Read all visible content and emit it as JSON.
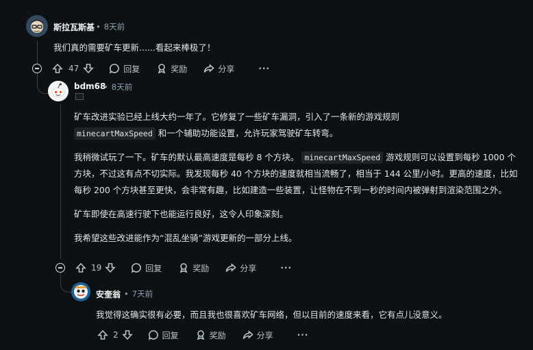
{
  "comments": [
    {
      "author": "斯拉瓦斯基",
      "time": "8天前",
      "body": "我们真的需要矿车更新......看起来棒极了！",
      "votes": "47",
      "reply_label": "回复",
      "award_label": "奖励",
      "share_label": "分享",
      "more_label": "···"
    },
    {
      "author": "bdm68",
      "time": "8天前",
      "p1a": "矿车改进实验已经上线大约一年了。它修复了一些矿车漏洞，引入了一条新的游戏规则",
      "p1code": "minecartMaxSpeed",
      "p1b": "和一个辅助功能设置，允许玩家驾驶矿车转弯。",
      "p2a": "我稍微试玩了一下。矿车的默认最高速度是每秒 8 个方块。",
      "p2code": "minecartMaxSpeed",
      "p2b": "游戏规则可以设置到每秒 1000 个方块，不过这有点不切实际。我发现每秒 40 个方块的速度就相当流畅了，相当于 144 公里/小时。更高的速度，比如每秒 200 个方块甚至更快，会非常有趣，比如建造一些装置，让怪物在不到一秒的时间内被弹射到渲染范围之外。",
      "p3": "矿车即使在高速行驶下也能运行良好，这令人印象深刻。",
      "p4": "我希望这些改进能作为“混乱坐骑”游戏更新的一部分上线。",
      "votes": "19",
      "reply_label": "回复",
      "award_label": "奖励",
      "share_label": "分享",
      "more_label": "···"
    },
    {
      "author": "安奎翁",
      "time": "7天前",
      "body": "我觉得这确实很有必要，而且我也很喜欢矿车网络，但以目前的速度来看，它有点儿没意义。",
      "votes": "2",
      "reply_label": "回复",
      "award_label": "奖励",
      "share_label": "分享",
      "more_label": "···"
    }
  ],
  "icons": {
    "upvote": "arrow-up-icon",
    "downvote": "arrow-down-icon",
    "reply": "speech-bubble-icon",
    "award": "award-icon",
    "share": "share-arrow-icon",
    "collapse": "minus-circle-icon"
  },
  "colors": {
    "background": "#0e1113",
    "text": "#e3e6e8",
    "meta": "#8ba2ad",
    "thread": "#3a3f44"
  }
}
